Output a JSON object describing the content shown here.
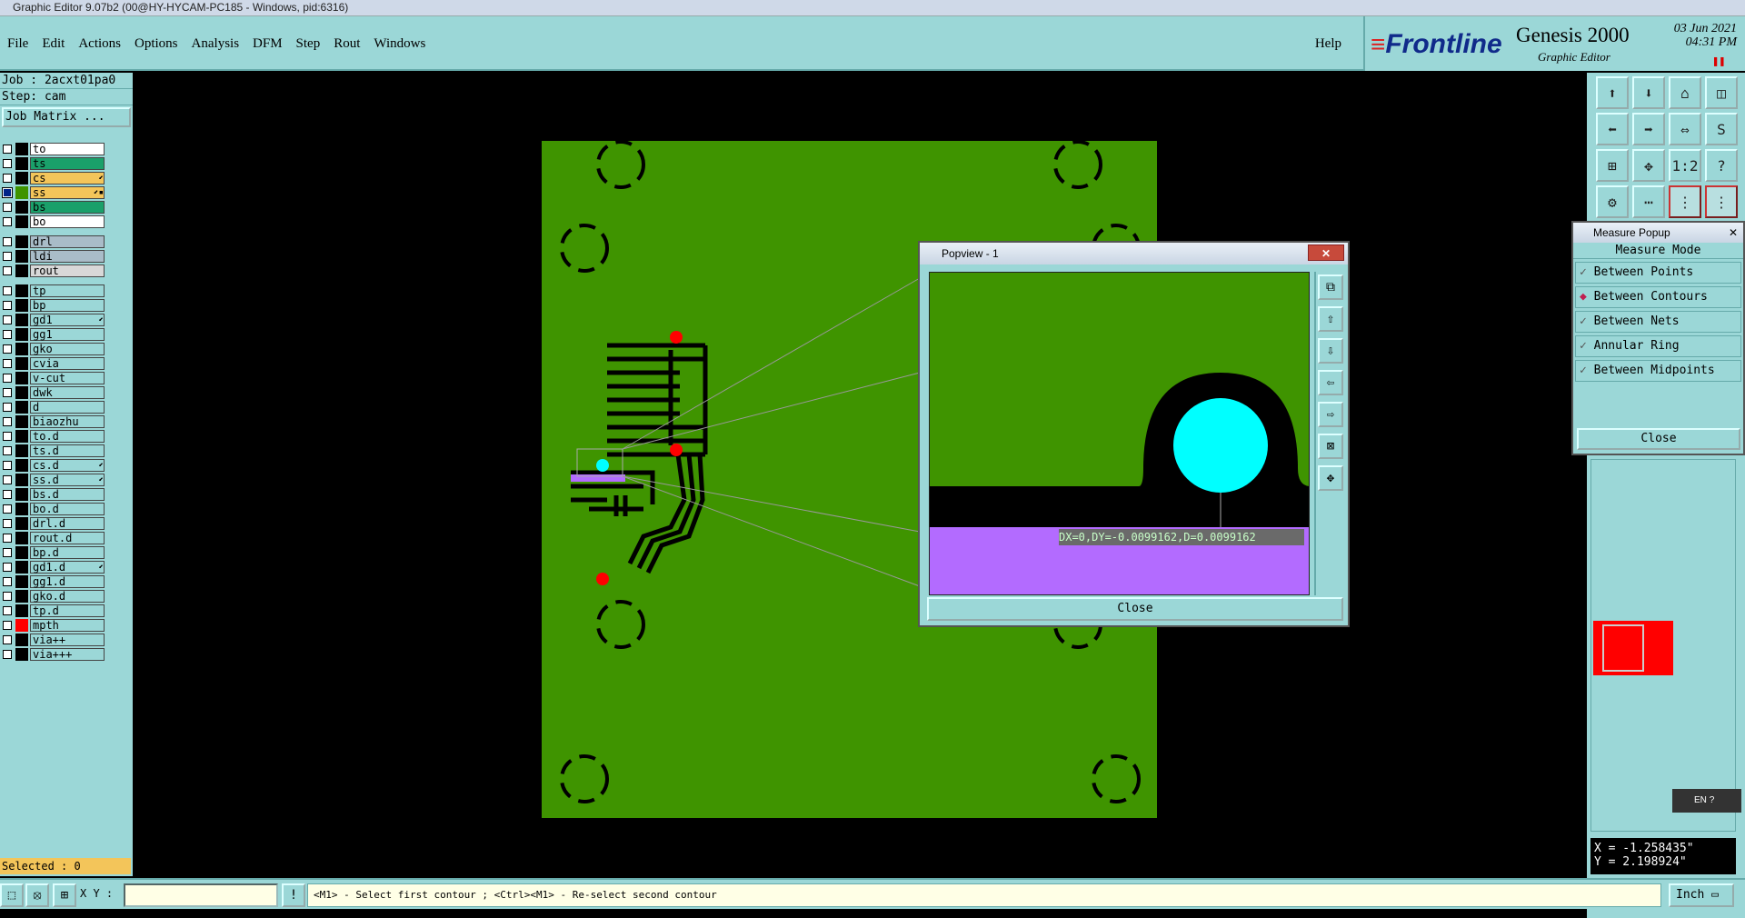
{
  "window_title": "Graphic Editor 9.07b2 (00@HY-HYCAM-PC185 - Windows, pid:6316)",
  "menu": [
    "File",
    "Edit",
    "Actions",
    "Options",
    "Analysis",
    "DFM",
    "Step",
    "Rout",
    "Windows"
  ],
  "help_label": "Help",
  "brand": {
    "logo": "Frontline",
    "product": "Genesis 2000",
    "subtitle": "Graphic Editor",
    "date": "03 Jun 2021",
    "time": "04:31 PM"
  },
  "job": {
    "job_line": "Job : 2acxt01pa0",
    "step_line": "Step: cam",
    "matrix_button": "Job Matrix ..."
  },
  "layers": [
    {
      "name": "to",
      "color": "#ffffff",
      "checked": false,
      "swatch": "#000000"
    },
    {
      "name": "ts",
      "color": "#1aa06a",
      "checked": false,
      "swatch": "#000000"
    },
    {
      "name": "cs",
      "color": "#f3c55a",
      "checked": false,
      "swatch": "#000000",
      "mark": "⬋"
    },
    {
      "name": "ss",
      "color": "#f3c55a",
      "checked": true,
      "swatch": "#3f9400",
      "mark": "⬋▪"
    },
    {
      "name": "bs",
      "color": "#1aa06a",
      "checked": false,
      "swatch": "#000000"
    },
    {
      "name": "bo",
      "color": "#ffffff",
      "checked": false,
      "swatch": "#000000"
    },
    {
      "gap": true
    },
    {
      "name": "drl",
      "color": "#a9bcc8",
      "checked": false,
      "swatch": "#000000"
    },
    {
      "name": "ldi",
      "color": "#a9bcc8",
      "checked": false,
      "swatch": "#000000"
    },
    {
      "name": "rout",
      "color": "#d8d8d8",
      "checked": false,
      "swatch": "#000000"
    },
    {
      "gap": true
    },
    {
      "name": "tp",
      "color": "#9bd7d7",
      "checked": false,
      "swatch": "#000000"
    },
    {
      "name": "bp",
      "color": "#9bd7d7",
      "checked": false,
      "swatch": "#000000"
    },
    {
      "name": "gd1",
      "color": "#9bd7d7",
      "checked": false,
      "swatch": "#000000",
      "mark": "⬋"
    },
    {
      "name": "gg1",
      "color": "#9bd7d7",
      "checked": false,
      "swatch": "#000000"
    },
    {
      "name": "gko",
      "color": "#9bd7d7",
      "checked": false,
      "swatch": "#000000"
    },
    {
      "name": "cvia",
      "color": "#9bd7d7",
      "checked": false,
      "swatch": "#000000"
    },
    {
      "name": "v-cut",
      "color": "#9bd7d7",
      "checked": false,
      "swatch": "#000000"
    },
    {
      "name": "dwk",
      "color": "#9bd7d7",
      "checked": false,
      "swatch": "#000000"
    },
    {
      "name": "d",
      "color": "#9bd7d7",
      "checked": false,
      "swatch": "#000000"
    },
    {
      "name": "biaozhu",
      "color": "#9bd7d7",
      "checked": false,
      "swatch": "#000000"
    },
    {
      "name": "to.d",
      "color": "#9bd7d7",
      "checked": false,
      "swatch": "#000000"
    },
    {
      "name": "ts.d",
      "color": "#9bd7d7",
      "checked": false,
      "swatch": "#000000"
    },
    {
      "name": "cs.d",
      "color": "#9bd7d7",
      "checked": false,
      "swatch": "#000000",
      "mark": "⬋"
    },
    {
      "name": "ss.d",
      "color": "#9bd7d7",
      "checked": false,
      "swatch": "#000000",
      "mark": "⬋"
    },
    {
      "name": "bs.d",
      "color": "#9bd7d7",
      "checked": false,
      "swatch": "#000000"
    },
    {
      "name": "bo.d",
      "color": "#9bd7d7",
      "checked": false,
      "swatch": "#000000"
    },
    {
      "name": "drl.d",
      "color": "#9bd7d7",
      "checked": false,
      "swatch": "#000000"
    },
    {
      "name": "rout.d",
      "color": "#9bd7d7",
      "checked": false,
      "swatch": "#000000"
    },
    {
      "name": "bp.d",
      "color": "#9bd7d7",
      "checked": false,
      "swatch": "#000000"
    },
    {
      "name": "gd1.d",
      "color": "#9bd7d7",
      "checked": false,
      "swatch": "#000000",
      "mark": "⬋"
    },
    {
      "name": "gg1.d",
      "color": "#9bd7d7",
      "checked": false,
      "swatch": "#000000"
    },
    {
      "name": "gko.d",
      "color": "#9bd7d7",
      "checked": false,
      "swatch": "#000000"
    },
    {
      "name": "tp.d",
      "color": "#9bd7d7",
      "checked": false,
      "swatch": "#000000"
    },
    {
      "name": "mpth",
      "color": "#9bd7d7",
      "checked": false,
      "swatch": "#ff0000"
    },
    {
      "name": "via++",
      "color": "#9bd7d7",
      "checked": false,
      "swatch": "#000000"
    },
    {
      "name": "via+++",
      "color": "#9bd7d7",
      "checked": false,
      "swatch": "#000000"
    }
  ],
  "selected_text": "Selected : 0",
  "popview": {
    "title": "Popview - 1",
    "measure_text": "DX=0,DY=-0.0099162,D=0.0099162",
    "close_label": "Close"
  },
  "measure_popup": {
    "title": "Measure Popup",
    "header": "Measure Mode",
    "options": [
      {
        "label": "Between Points",
        "selected": false
      },
      {
        "label": "Between Contours",
        "selected": true
      },
      {
        "label": "Between Nets",
        "selected": false
      },
      {
        "label": "Annular Ring",
        "selected": false
      },
      {
        "label": "Between Midpoints",
        "selected": false
      }
    ],
    "close_label": "Close"
  },
  "coords": {
    "x": "X = -1.258435\"",
    "y": "Y = 2.198924\""
  },
  "lang": "EN",
  "status": {
    "xy_label": "X Y :",
    "xy_value": "",
    "prompt": "<M1> - Select first contour ; <Ctrl><M1> - Re-select second contour",
    "unit": "Inch"
  },
  "colors": {
    "panel": "#9bd7d7",
    "board": "#3f9400",
    "pad": "#00ffff",
    "feature": "#b36bff",
    "selected_pad": "#ff0000"
  }
}
